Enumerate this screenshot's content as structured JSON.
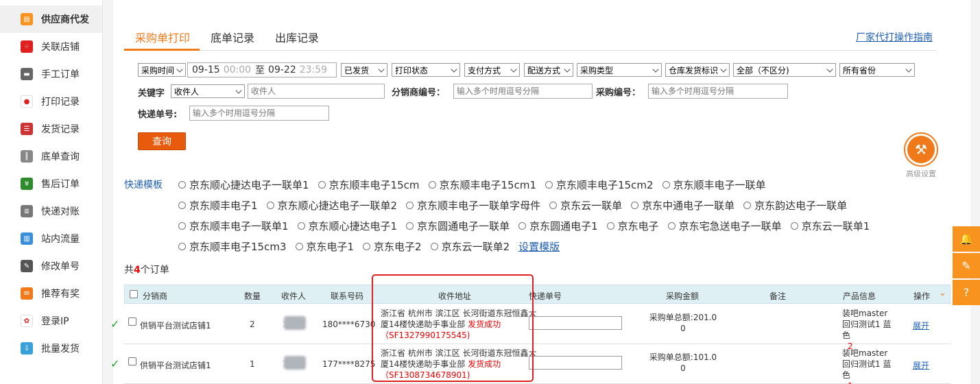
{
  "sidebar": {
    "items": [
      {
        "label": "供应商代发",
        "icon": "printer-icon",
        "color": "#f7931e",
        "glyph": "▤",
        "active": true
      },
      {
        "label": "关联店铺",
        "icon": "dice-icon",
        "color": "#e0201e",
        "glyph": "⁘"
      },
      {
        "label": "手工订单",
        "icon": "keyboard-icon",
        "color": "#666666",
        "glyph": "▬"
      },
      {
        "label": "打印记录",
        "icon": "flickr-dots-icon",
        "color": "#ffffff",
        "glyph": "●"
      },
      {
        "label": "发货记录",
        "icon": "list-icon",
        "color": "#cc3333",
        "glyph": "☰"
      },
      {
        "label": "底单查询",
        "icon": "barcode-icon",
        "color": "#888888",
        "glyph": "║"
      },
      {
        "label": "售后订单",
        "icon": "return-money-icon",
        "color": "#2e8b2e",
        "glyph": "¥"
      },
      {
        "label": "快递对账",
        "icon": "ledger-icon",
        "color": "#777777",
        "glyph": "≣"
      },
      {
        "label": "站内流量",
        "icon": "monitor-chart-icon",
        "color": "#3a8fd9",
        "glyph": "▥"
      },
      {
        "label": "修改单号",
        "icon": "pencil-icon",
        "color": "#555555",
        "glyph": "✎"
      },
      {
        "label": "推荐有奖",
        "icon": "gift-icon",
        "color": "#f07a1a",
        "glyph": "✉"
      },
      {
        "label": "登录IP",
        "icon": "photo-pinwheel-icon",
        "color": "#ffffff",
        "glyph": "✿"
      },
      {
        "label": "批量发货",
        "icon": "inbox-icon",
        "color": "#3aa0d9",
        "glyph": "⇩"
      }
    ]
  },
  "tabs": [
    {
      "label": "采购单打印",
      "active": true
    },
    {
      "label": "底单记录"
    },
    {
      "label": "出库记录"
    }
  ],
  "guide_link": "厂家代打操作指南",
  "filters": {
    "time_type": "采购时间",
    "date_start": "09-15",
    "time_start": "00:00",
    "date_to": "至",
    "date_end": "09-22",
    "time_end": "23:59",
    "ship_status": "已发货",
    "print_status": "打印状态",
    "pay_method": "支付方式",
    "delivery_method": "配送方式",
    "purchase_type": "采购类型",
    "warehouse_flag": "仓库发货标识",
    "scope": "全部（不区分)",
    "province": "所有省份"
  },
  "keyword": {
    "label": "关键字",
    "type_value": "收件人",
    "placeholder": "收件人"
  },
  "distributor_no": {
    "label": "分销商编号：",
    "placeholder": "输入多个时用逗号分隔"
  },
  "purchase_no": {
    "label": "采购编号：",
    "placeholder": "输入多个时用逗号分隔"
  },
  "express_no": {
    "label": "快递单号:",
    "placeholder": "输入多个时用逗号分隔"
  },
  "query_button": "查询",
  "advanced": {
    "label": "高级设置",
    "icon": "tools-icon"
  },
  "templates": {
    "label": "快递模板",
    "rows": [
      [
        "京东顺心捷达电子一联单1",
        "京东顺丰电子15cm",
        "京东顺丰电子15cm1",
        "京东顺丰电子15cm2",
        "京东顺丰电子一联单"
      ],
      [
        "京东顺丰电子1",
        "京东顺心捷达电子一联单2",
        "京东顺丰电子一联单字母件",
        "京东云一联单",
        "京东中通电子一联单",
        "京东韵达电子一联单"
      ],
      [
        "京东顺丰电子一联单1",
        "京东顺心捷达电子1",
        "京东圆通电子一联单",
        "京东圆通电子1",
        "京东电子",
        "京东宅急送电子一联单",
        "京东云一联单1"
      ],
      [
        "京东顺丰电子15cm3",
        "京东电子1",
        "京东电子2",
        "京东云一联单2"
      ]
    ],
    "setting_link": "设置模版"
  },
  "order_count": {
    "prefix": "共",
    "count": "4",
    "suffix": "个订单"
  },
  "table": {
    "headers": {
      "distributor": "分销商",
      "qty": "数量",
      "receiver": "收件人",
      "phone": "联系号码",
      "address": "收件地址",
      "express": "快递单号",
      "amount": "采购金额",
      "remark": "备注",
      "product": "产品信息",
      "action": "操作"
    },
    "rows": [
      {
        "distributor": "供销平台测试店铺1",
        "qty": "2",
        "receiver": "1",
        "phone": "180****6730",
        "address": "浙江省 杭州市 滨江区 长河街道东冠恒鑫大厦14楼快递助手事业部",
        "status": "发货成功（SF1327990175545)",
        "amount_label": "采购单总额:201.0",
        "amount_sub": "0",
        "product_name": "装吧master回归测试1 蓝色",
        "product_qty": "2",
        "action": "展开"
      },
      {
        "distributor": "供销平台测试店铺1",
        "qty": "1",
        "receiver": "1",
        "phone": "177****8275",
        "address": "浙江省 杭州市 滨江区 长河街道东冠恒鑫大厦14楼快递助手事业部",
        "status": "发货成功（SF1308734678901)",
        "amount_label": "采购单总额:101.0",
        "amount_sub": "0",
        "product_name": "装吧master回归测试1 蓝色",
        "product_qty": "1",
        "action": "展开"
      }
    ]
  },
  "float_bar": [
    {
      "icon": "bell-icon",
      "glyph": "🔔"
    },
    {
      "icon": "edit-note-icon",
      "glyph": "✎"
    },
    {
      "icon": "help-icon",
      "glyph": "?"
    }
  ],
  "colors": {
    "accent": "#f07a1a",
    "link": "#1e5fb4",
    "success": "#e00000",
    "highlight_box": "#e0201e"
  }
}
